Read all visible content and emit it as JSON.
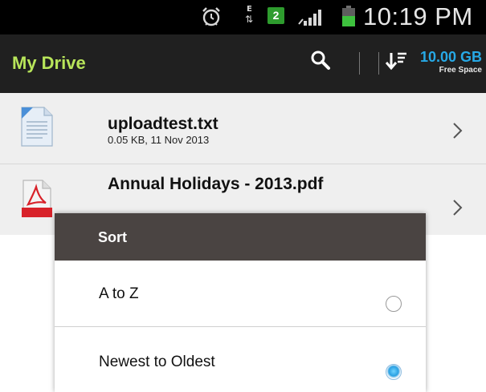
{
  "status_bar": {
    "time": "10:19 PM",
    "notification_count": "2",
    "usb_label": "E",
    "icons": [
      "alarm-icon",
      "usb-debug-icon",
      "signal-icon",
      "battery-icon"
    ]
  },
  "action_bar": {
    "title": "My Drive",
    "storage_value": "10.00 GB",
    "storage_label": "Free Space",
    "icons": [
      "search-icon",
      "sort-icon"
    ]
  },
  "files": [
    {
      "name": "uploadtest.txt",
      "meta": "0.05 KB, 11 Nov 2013",
      "icon": "text-file-icon"
    },
    {
      "name": "Annual Holidays - 2013.pdf",
      "meta": "",
      "icon": "pdf-file-icon"
    }
  ],
  "sort_dialog": {
    "title": "Sort",
    "options": [
      {
        "label": "A to Z",
        "selected": false
      },
      {
        "label": "Newest to Oldest",
        "selected": true
      }
    ]
  },
  "colors": {
    "title_accent": "#b8e55a",
    "storage_accent": "#27a9e6",
    "dialog_header": "#4a4442",
    "notification_badge": "#2e9c2e"
  }
}
